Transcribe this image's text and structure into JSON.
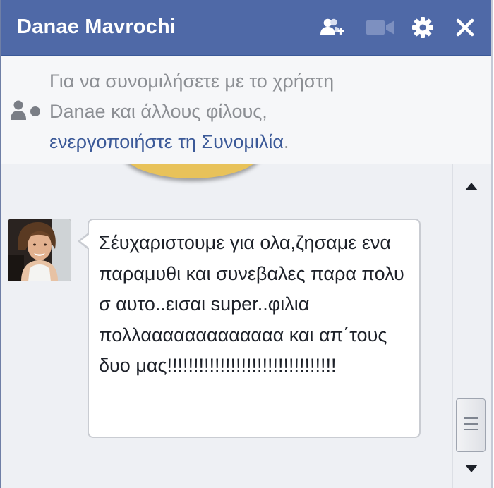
{
  "chat": {
    "title": "Danae Mavrochi",
    "icons": {
      "add_friend": "add-friend-icon",
      "video": "video-camera-icon",
      "settings": "gear-icon",
      "close": "close-icon"
    }
  },
  "notice": {
    "icon": "users-status-icon",
    "line1": "Για να συνομιλήσετε με το χρήστη",
    "line2": "Danae και άλλους φίλους,",
    "link": "ενεργοποιήστε τη Συνομιλία",
    "suffix": "."
  },
  "messages": [
    {
      "sender_avatar": "sender-photo",
      "text": "Σέυχαριστουμε για ολα,ζησαμε ενα παραμυθι και συνεβαλες παρα πολυ σ αυτο..εισαι super..φιλια πολλααααααααααααα και απ΄τους δυο μας!!!!!!!!!!!!!!!!!!!!!!!!!!!!!!!!"
    }
  ],
  "colors": {
    "titlebar": "#4f69a7",
    "link": "#3b5998",
    "muted_text": "#8c8f94",
    "chat_background": "#eef0f4"
  }
}
